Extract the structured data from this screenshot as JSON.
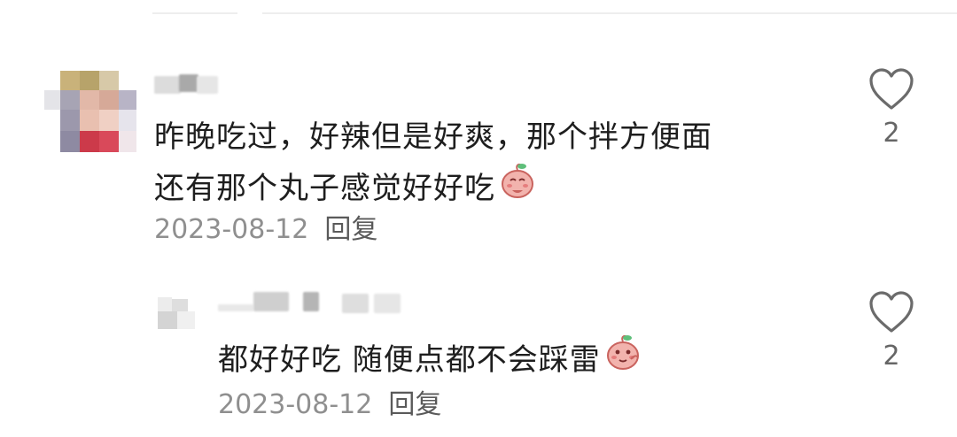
{
  "comments": [
    {
      "text_lines": [
        "昨晚吃过，好辣但是好爽，那个拌方便面",
        "还有那个丸子感觉好好吃"
      ],
      "emoji": "peach-emoji",
      "date": "2023-08-12",
      "reply_label": "回复",
      "like_icon": "heart-outline-icon",
      "like_count": "2"
    },
    {
      "text_lines": [
        "都好好吃 随便点都不会踩雷"
      ],
      "emoji": "peach-emoji",
      "date": "2023-08-12",
      "reply_label": "回复",
      "like_icon": "heart-outline-icon",
      "like_count": "2"
    }
  ],
  "colors": {
    "text": "#1e1e1e",
    "meta": "#8f8f8f",
    "reply": "#5a5a5a",
    "icon": "#6b6b6b",
    "peach": "#f2b3ad",
    "leaf": "#5fbf7a"
  }
}
